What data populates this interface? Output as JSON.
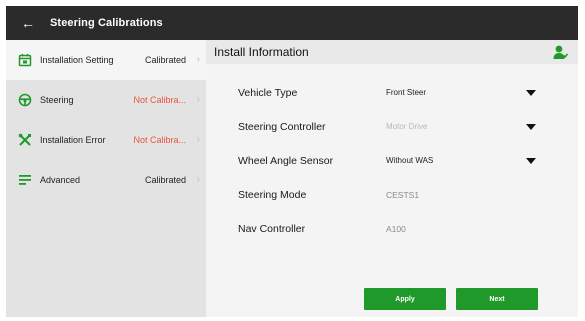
{
  "header": {
    "back_icon": "arrow-left-icon",
    "title": "Steering Calibrations"
  },
  "colors": {
    "accent_green": "#1f9a2a",
    "status_warning": "#e8553b",
    "titlebar": "#2b2b2b"
  },
  "sidebar": {
    "items": [
      {
        "icon": "calendar-icon",
        "label": "Installation Setting",
        "status": "Calibrated",
        "status_type": "ok",
        "active": true
      },
      {
        "icon": "steering-wheel-icon",
        "label": "Steering",
        "status": "Not Calibra...",
        "status_type": "warning",
        "active": false
      },
      {
        "icon": "tools-icon",
        "label": "Installation Error",
        "status": "Not Calibra...",
        "status_type": "warning",
        "active": false
      },
      {
        "icon": "list-icon",
        "label": "Advanced",
        "status": "Calibrated",
        "status_type": "ok",
        "active": false
      }
    ]
  },
  "main": {
    "title": "Install Information",
    "header_icon": "user-icon",
    "fields": [
      {
        "label": "Vehicle Type",
        "value": "Front Steer",
        "kind": "select"
      },
      {
        "label": "Steering Controller",
        "value": "Motor Drive",
        "kind": "select-disabled"
      },
      {
        "label": "Wheel Angle Sensor",
        "value": "Without WAS",
        "kind": "select"
      },
      {
        "label": "Steering Mode",
        "value": "CESTS1",
        "kind": "static"
      },
      {
        "label": "Nav Controller",
        "value": "A100",
        "kind": "static"
      }
    ],
    "apply_label": "Apply",
    "next_label": "Next"
  }
}
